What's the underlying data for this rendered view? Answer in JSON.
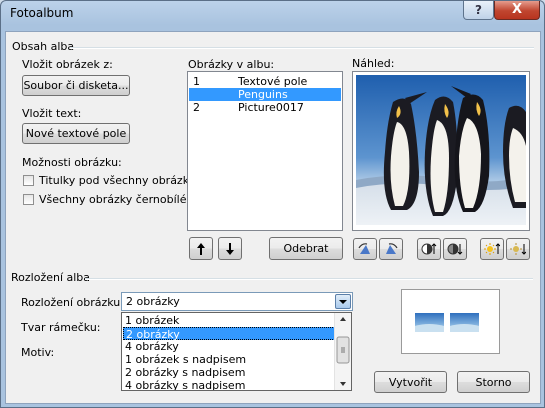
{
  "window": {
    "title": "Fotoalbum",
    "help_glyph": "?",
    "close_glyph": "X"
  },
  "album_content": {
    "group_title": "Obsah alba",
    "insert_picture_label": "Vložit obrázek z:",
    "file_button": "Soubor či disketa...",
    "insert_text_label": "Vložit text:",
    "textbox_button": "Nové textové pole",
    "picture_options_label": "Možnosti obrázku:",
    "captions_checkbox": "Titulky pod všechny obrázky",
    "captions_checked": false,
    "bw_checkbox": "Všechny obrázky černobílé",
    "bw_checked": false
  },
  "pictures_list": {
    "label": "Obrázky v albu:",
    "items": [
      {
        "num": "1",
        "name": "Textové pole",
        "selected": false
      },
      {
        "num": "",
        "name": "Penguins",
        "selected": true
      },
      {
        "num": "2",
        "name": "Picture0017",
        "selected": false
      }
    ],
    "move_up_icon": "arrow-up-icon",
    "move_down_icon": "arrow-down-icon",
    "remove_button": "Odebrat"
  },
  "preview": {
    "label": "Náhled:",
    "tools": [
      "rotate-left-icon",
      "rotate-right-icon",
      "contrast-up-icon",
      "contrast-down-icon",
      "brightness-up-icon",
      "brightness-down-icon"
    ]
  },
  "album_layout": {
    "group_title": "Rozložení alba",
    "picture_layout_label": "Rozložení obrázku:",
    "picture_layout_value": "2 obrázky",
    "frame_shape_label": "Tvar rámečku:",
    "theme_label": "Motiv:",
    "dropdown_options": [
      {
        "label": "1 obrázek",
        "selected": false
      },
      {
        "label": "2 obrázky",
        "selected": true
      },
      {
        "label": "4 obrázky",
        "selected": false
      },
      {
        "label": "1 obrázek s nadpisem",
        "selected": false
      },
      {
        "label": "2 obrázky s nadpisem",
        "selected": false
      },
      {
        "label": "4 obrázky s nadpisem",
        "selected": false
      }
    ]
  },
  "footer": {
    "create_button": "Vytvořit",
    "cancel_button": "Storno"
  },
  "colors": {
    "selection": "#3399ff",
    "title_bar": "#a9c3df",
    "close_button": "#c0452f"
  }
}
